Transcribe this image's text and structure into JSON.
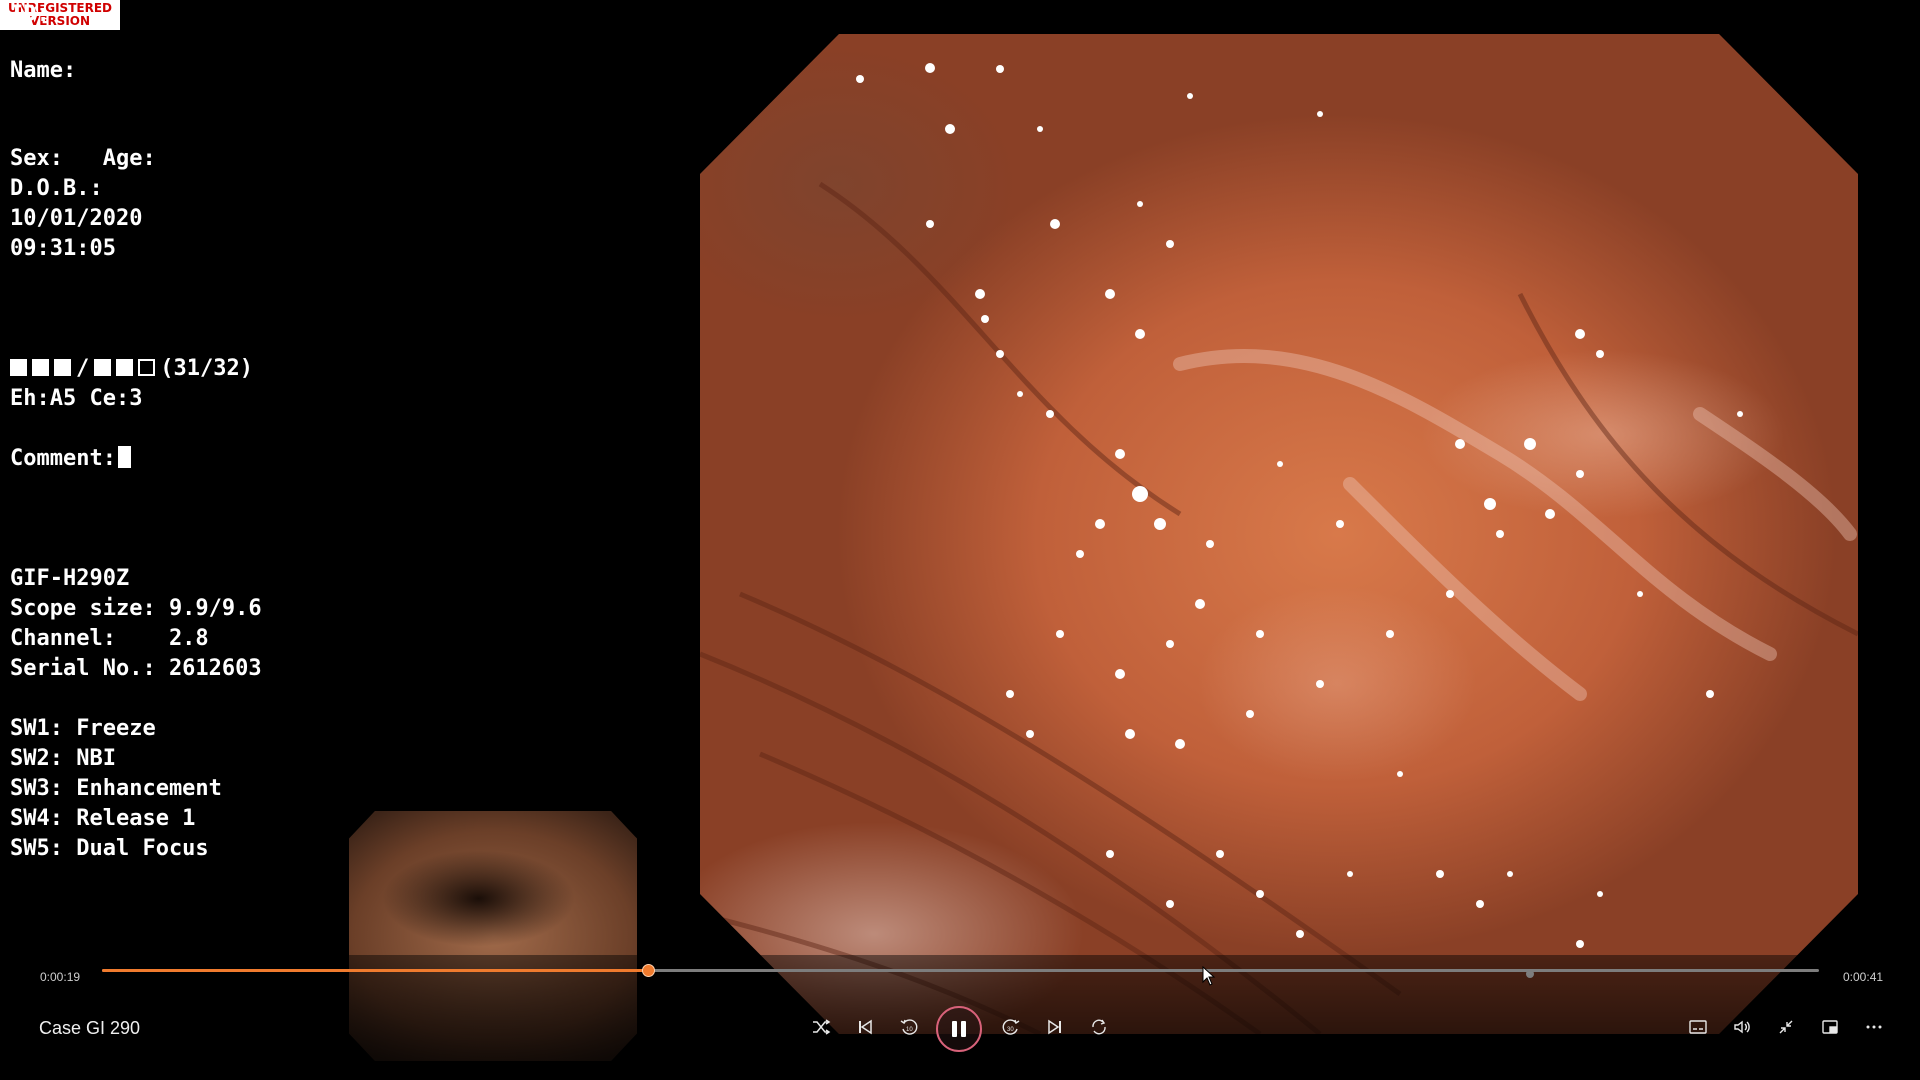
{
  "watermark": {
    "line1": "UNREGISTERED",
    "line2": "VERSION"
  },
  "patient": {
    "id_label": "ID:",
    "name_label": "Name:",
    "sex_age_label": "Sex:   Age:",
    "dob_label": "D.O.B.:",
    "date": "10/01/2020",
    "time": "09:31:05",
    "frame_counter": "(31/32)",
    "enhance": "Eh:A5 Ce:3",
    "comment_label": "Comment:"
  },
  "scope": {
    "model": "GIF-H290Z",
    "scope_size": "Scope size: 9.9/9.6",
    "channel": "Channel:    2.8",
    "serial": "Serial No.: 2612603"
  },
  "switches": [
    "SW1: Freeze",
    "SW2: NBI",
    "SW3: Enhancement",
    "SW4: Release 1",
    "SW5: Dual Focus"
  ],
  "player": {
    "current_time": "0:00:19",
    "duration": "0:00:41",
    "progress": 0.318,
    "title": "Case GI 290"
  },
  "icons": [
    "shuffle-icon",
    "skip-previous-icon",
    "rewind-10-icon",
    "pause-icon",
    "forward-30-icon",
    "skip-next-icon",
    "repeat-icon",
    "subtitles-icon",
    "volume-icon",
    "exit-fullscreen-icon",
    "mini-player-icon",
    "more-icon"
  ],
  "colors": {
    "accent": "#f07b2e",
    "play_ring": "#d8627a"
  }
}
